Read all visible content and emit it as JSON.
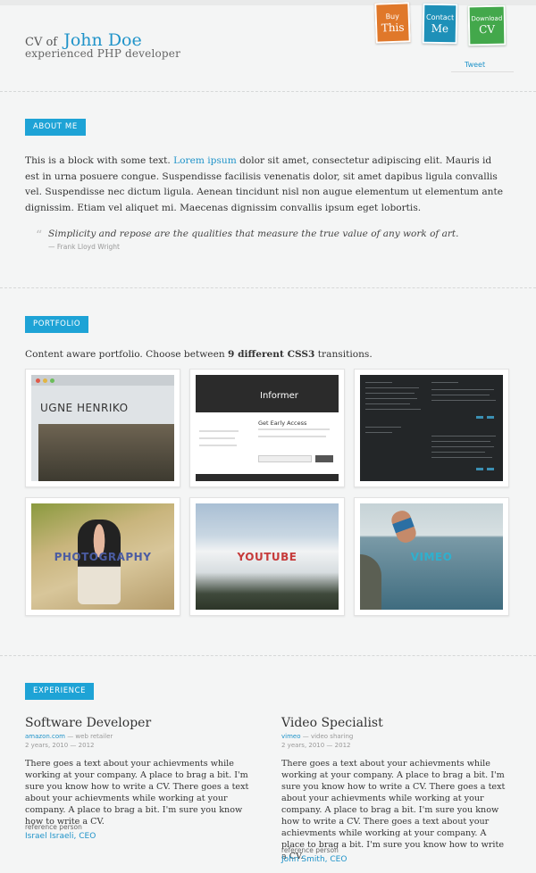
{
  "header": {
    "cv_of": "CV of",
    "name": "John Doe",
    "tagline": "experienced PHP developer",
    "tags": [
      {
        "small": "Buy",
        "big": "This",
        "color": "#e0782a"
      },
      {
        "small": "Contact",
        "big": "Me",
        "color": "#1e90b8"
      },
      {
        "small": "Download",
        "big": "CV",
        "color": "#43a84b"
      }
    ],
    "tweet": "Tweet"
  },
  "about": {
    "label": "ABOUT ME",
    "text_before_link": "This is a block with some text. ",
    "link": "Lorem ipsum",
    "text_after_link": " dolor sit amet, consectetur adipiscing elit. Mauris id est in urna posuere congue. Suspendisse facilisis venenatis dolor, sit amet dapibus ligula convallis vel. Suspendisse nec dictum ligula. Aenean tincidunt nisl non augue elementum ut elementum ante dignissim. Etiam vel aliquet mi. Maecenas dignissim convallis ipsum eget lobortis.",
    "quote_mark": "“",
    "quote": "Simplicity and repose are the qualities that measure the true value of any work of art.",
    "quote_author": "— Frank Lloyd Wright"
  },
  "portfolio": {
    "label": "PORTFOLIO",
    "intro_before": "Content aware portfolio. Choose between ",
    "intro_bold": "9 different CSS3",
    "intro_after": " transitions.",
    "items": [
      {
        "caption": "UGNE HENRIKO"
      },
      {
        "caption": "Informer",
        "cta": "Get Early Access"
      },
      {
        "caption": ""
      },
      {
        "caption": "PHOTOGRAPHY"
      },
      {
        "caption": "YOUTUBE"
      },
      {
        "caption": "VIMEO"
      }
    ]
  },
  "experience": {
    "label": "EXPERIENCE",
    "jobs": [
      {
        "title": "Software Developer",
        "company": "amazon.com",
        "role": " — web retailer",
        "period": "2 years, 2010 — 2012",
        "text": "There goes a text about your achievments while working at your company. A place to brag a bit. I'm sure you know how to write a CV. There goes a text about your achievments while working at your company. A place to brag a bit. I'm sure you know how to write a CV.",
        "ref_label": "reference person",
        "ref_name": "Israel Israeli, CEO"
      },
      {
        "title": "Video Specialist",
        "company": "vimeo",
        "role": " — video sharing",
        "period": "2 years, 2010 — 2012",
        "text": "There goes a text about your achievments while working at your company. A place to brag a bit. I'm sure you know how to write a CV. There goes a text about your achievments while working at your company. A place to brag a bit. I'm sure you know how to write a CV. There goes a text about your achievments while working at your company. A place to brag a bit. I'm sure you know how to write a CV.",
        "ref_label": "reference person",
        "ref_name": "John Smith, CEO"
      }
    ]
  }
}
